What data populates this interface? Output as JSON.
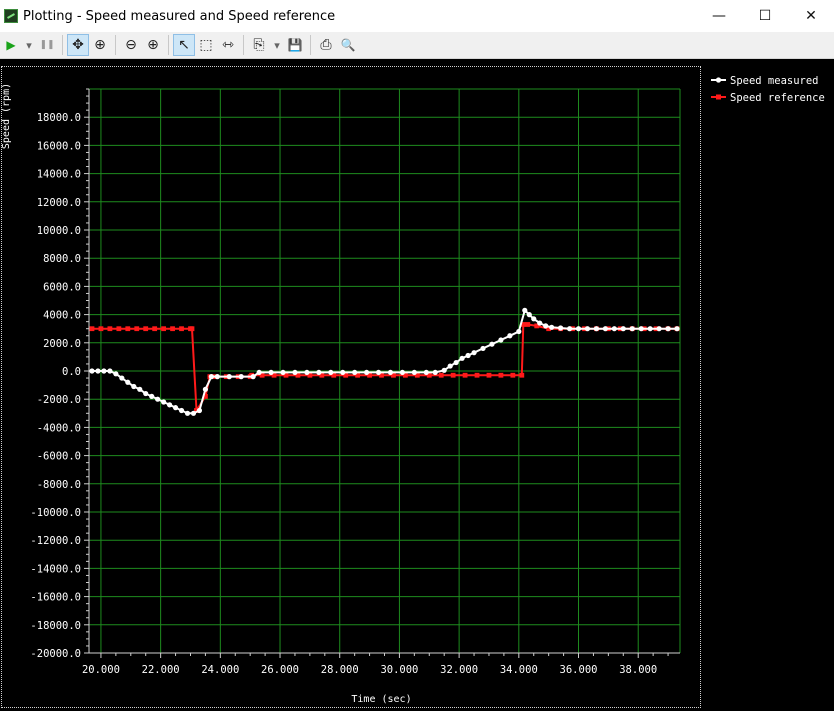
{
  "window": {
    "title": "Plotting  - Speed measured and Speed reference",
    "minimize": "—",
    "maximize": "☐",
    "close": "✕"
  },
  "toolbar": {
    "play": "▶",
    "play_menu": "▾",
    "pause": "❚❚",
    "pan": "✥",
    "zoom_fit": "⊕",
    "zoom_out": "⊖",
    "zoom_in": "⊕",
    "select": "↖",
    "box_select": "⬚",
    "cursor": "⇿",
    "copy": "⎘",
    "copy_menu": "▾",
    "save": "💾",
    "print": "⎙",
    "print_preview": "🔍"
  },
  "chart_data": {
    "type": "line",
    "title": "",
    "xlabel": "Time (sec)",
    "ylabel": "Speed (rpm)",
    "xlim": [
      19.6,
      39.4
    ],
    "ylim": [
      -20000,
      20000
    ],
    "x_ticks": [
      20,
      22,
      24,
      26,
      28,
      30,
      32,
      34,
      36,
      38
    ],
    "x_tick_labels": [
      "20.000",
      "22.000",
      "24.000",
      "26.000",
      "28.000",
      "30.000",
      "32.000",
      "34.000",
      "36.000",
      "38.000"
    ],
    "y_ticks": [
      18000,
      16000,
      14000,
      12000,
      10000,
      8000,
      6000,
      4000,
      2000,
      0,
      -2000,
      -4000,
      -6000,
      -8000,
      -10000,
      -12000,
      -14000,
      -16000,
      -18000,
      -20000
    ],
    "y_tick_labels": [
      "18000.0",
      "16000.0",
      "14000.0",
      "12000.0",
      "10000.0",
      "8000.0",
      "6000.0",
      "4000.0",
      "2000.0",
      "0.0",
      "-2000.0",
      "-4000.0",
      "-6000.0",
      "-8000.0",
      "-10000.0",
      "-12000.0",
      "-14000.0",
      "-16000.0",
      "-18000.0",
      "-20000.0"
    ],
    "grid": true,
    "legend": "top-right outside",
    "colors": {
      "background": "#000000",
      "grid": "#1e8c1e",
      "axis": "#cfcfcf",
      "text": "#ffffff"
    },
    "series": [
      {
        "name": "Speed measured",
        "color": "#ffffff",
        "x": [
          19.7,
          19.9,
          20.1,
          20.3,
          20.5,
          20.7,
          20.9,
          21.1,
          21.3,
          21.5,
          21.7,
          21.9,
          22.1,
          22.3,
          22.5,
          22.7,
          22.9,
          23.1,
          23.3,
          23.5,
          23.7,
          23.9,
          24.3,
          24.7,
          25.1,
          25.3,
          25.7,
          26.1,
          26.5,
          26.9,
          27.3,
          27.7,
          28.1,
          28.5,
          28.9,
          29.3,
          29.7,
          30.1,
          30.5,
          30.9,
          31.2,
          31.5,
          31.7,
          31.9,
          32.1,
          32.3,
          32.5,
          32.8,
          33.1,
          33.4,
          33.7,
          34.0,
          34.2,
          34.35,
          34.5,
          34.7,
          34.9,
          35.1,
          35.4,
          35.7,
          36.0,
          36.3,
          36.6,
          36.9,
          37.2,
          37.5,
          37.8,
          38.1,
          38.4,
          38.7,
          39.0,
          39.3
        ],
        "y": [
          0,
          0,
          0,
          0,
          -200,
          -500,
          -800,
          -1100,
          -1300,
          -1600,
          -1800,
          -2000,
          -2200,
          -2400,
          -2600,
          -2800,
          -3000,
          -3000,
          -2800,
          -1300,
          -400,
          -400,
          -400,
          -400,
          -400,
          -100,
          -100,
          -100,
          -100,
          -100,
          -100,
          -100,
          -100,
          -100,
          -100,
          -100,
          -100,
          -100,
          -100,
          -100,
          -100,
          50,
          350,
          600,
          900,
          1100,
          1300,
          1600,
          1900,
          2200,
          2500,
          2800,
          4300,
          4000,
          3700,
          3400,
          3200,
          3100,
          3050,
          3000,
          3000,
          3000,
          3000,
          3000,
          3000,
          3000,
          3000,
          3000,
          3000,
          3000,
          3000,
          3000
        ]
      },
      {
        "name": "Speed reference",
        "color": "#ff1a1a",
        "x": [
          19.7,
          20.0,
          20.3,
          20.6,
          20.9,
          21.2,
          21.5,
          21.8,
          22.1,
          22.4,
          22.7,
          23.0,
          23.05,
          23.2,
          23.5,
          23.65,
          23.8,
          24.2,
          24.6,
          25.0,
          25.05,
          25.4,
          25.8,
          26.2,
          26.6,
          27.0,
          27.4,
          27.8,
          28.2,
          28.6,
          29.0,
          29.4,
          29.8,
          30.2,
          30.6,
          31.0,
          31.4,
          31.8,
          32.2,
          32.6,
          33.0,
          33.4,
          33.8,
          34.1,
          34.15,
          34.3,
          34.6,
          35.0,
          35.4,
          35.8,
          36.2,
          36.6,
          37.0,
          37.4,
          37.8,
          38.2,
          38.6,
          39.0,
          39.3
        ],
        "y": [
          3000,
          3000,
          3000,
          3000,
          3000,
          3000,
          3000,
          3000,
          3000,
          3000,
          3000,
          3000,
          3000,
          -2800,
          -1800,
          -400,
          -400,
          -400,
          -400,
          -400,
          -300,
          -300,
          -300,
          -300,
          -300,
          -300,
          -300,
          -300,
          -300,
          -300,
          -300,
          -300,
          -300,
          -300,
          -300,
          -300,
          -300,
          -300,
          -300,
          -300,
          -300,
          -300,
          -300,
          -300,
          3300,
          3300,
          3200,
          3000,
          3000,
          3000,
          3000,
          3000,
          3000,
          3000,
          3000,
          3000,
          3000,
          3000,
          3000
        ]
      }
    ]
  }
}
